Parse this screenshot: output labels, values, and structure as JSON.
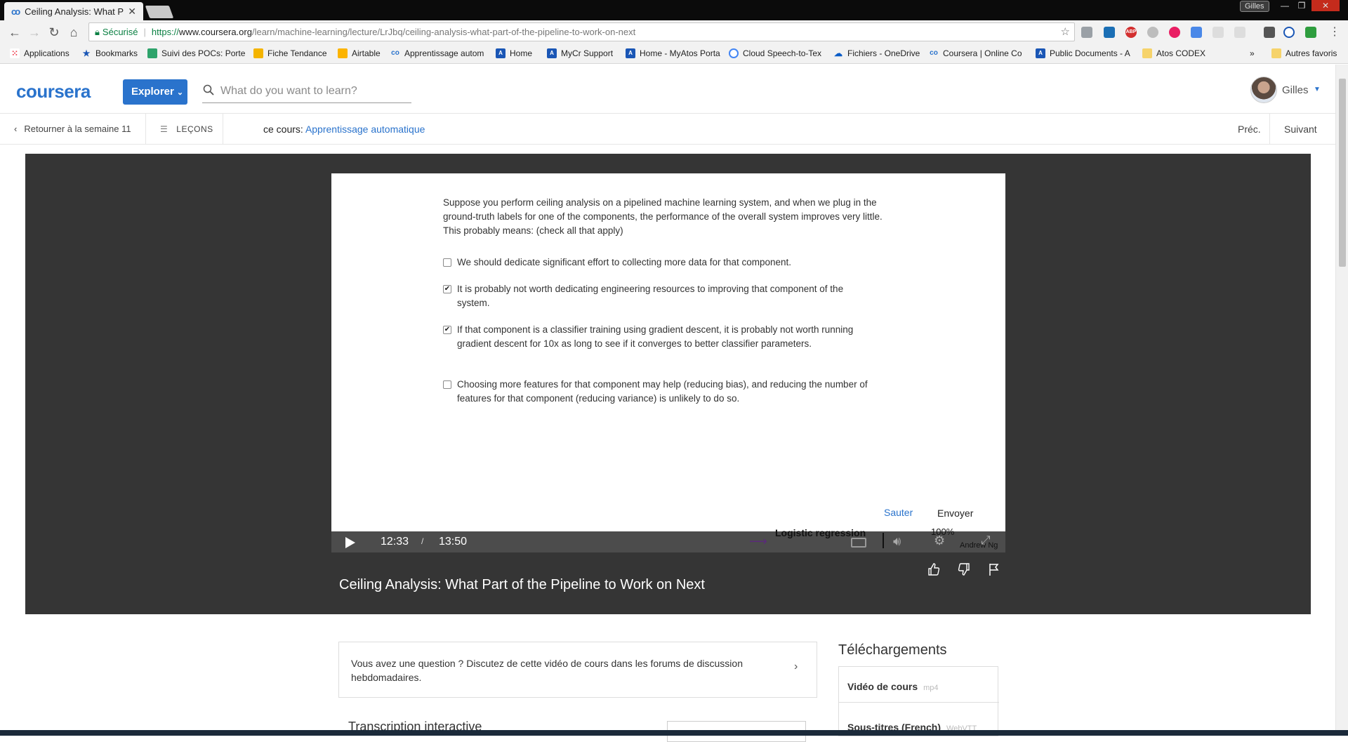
{
  "browser": {
    "tab_title": "Ceiling Analysis: What Pa",
    "profile": "Gilles",
    "url_secure_label": "Sécurisé",
    "url_scheme": "https://",
    "url_host": "www.coursera.org",
    "url_path": "/learn/machine-learning/lecture/LrJbq/ceiling-analysis-what-part-of-the-pipeline-to-work-on-next",
    "bookmarks": [
      "Applications",
      "Bookmarks",
      "Suivi des POCs: Porte",
      "Fiche Tendance",
      "Airtable",
      "Apprentissage autom",
      "Home",
      "MyCr Support",
      "Home - MyAtos Porta",
      "Cloud Speech-to-Tex",
      "Fichiers - OneDrive",
      "Coursera | Online Co",
      "Public Documents - A",
      "Atos CODEX"
    ],
    "bookmarks_overflow": "»",
    "other_bookmarks": "Autres favoris"
  },
  "header": {
    "logo": "coursera",
    "explore_label": "Explorer",
    "search_placeholder": "What do you want to learn?",
    "user_name": "Gilles"
  },
  "lesson_nav": {
    "back_label": "Retourner à la semaine 11",
    "lessons_label": "LEÇONS",
    "course_prefix": "ce cours:",
    "course_name": "Apprentissage automatique",
    "prev_label": "Préc.",
    "next_label": "Suivant"
  },
  "quiz": {
    "question": "Suppose you perform ceiling analysis on a pipelined machine learning system, and when we plug in the ground-truth labels for one of the components, the performance of the overall system improves very little. This probably means: (check all that apply)",
    "options": [
      {
        "text": "We should dedicate significant effort to collecting more data for that component.",
        "checked": false
      },
      {
        "text": "It is probably not worth dedicating engineering resources to improving that component of the system.",
        "checked": true
      },
      {
        "text": "If that component is a classifier training using gradient descent, it is probably not worth running gradient descent for 10x as long to see if it converges to better classifier parameters.",
        "checked": true
      },
      {
        "text": "Choosing more features for that component may help (reducing bias), and reducing the number of features for that component (reducing variance) is unlikely to do so.",
        "checked": false
      }
    ],
    "skip_label": "Sauter",
    "submit_label": "Envoyer"
  },
  "player": {
    "current_time": "12:33",
    "separator": "/",
    "total_time": "13:50",
    "slide_text": "Logistic regression",
    "zoom": "100%",
    "presenter": "Andrew Ng"
  },
  "video": {
    "title": "Ceiling Analysis: What Part of the Pipeline to Work on Next"
  },
  "discussion": {
    "text": "Vous avez une question ? Discutez de cette vidéo de cours dans les forums de discussion hebdomadaires."
  },
  "downloads": {
    "title": "Téléchargements",
    "items": [
      {
        "label": "Vidéo de cours",
        "format": "mp4"
      },
      {
        "label": "Sous-titres (French)",
        "format": "WebVTT"
      }
    ]
  },
  "transcript": {
    "title": "Transcription interactive"
  },
  "colors": {
    "brand": "#2a73cc",
    "stage": "#353535"
  }
}
